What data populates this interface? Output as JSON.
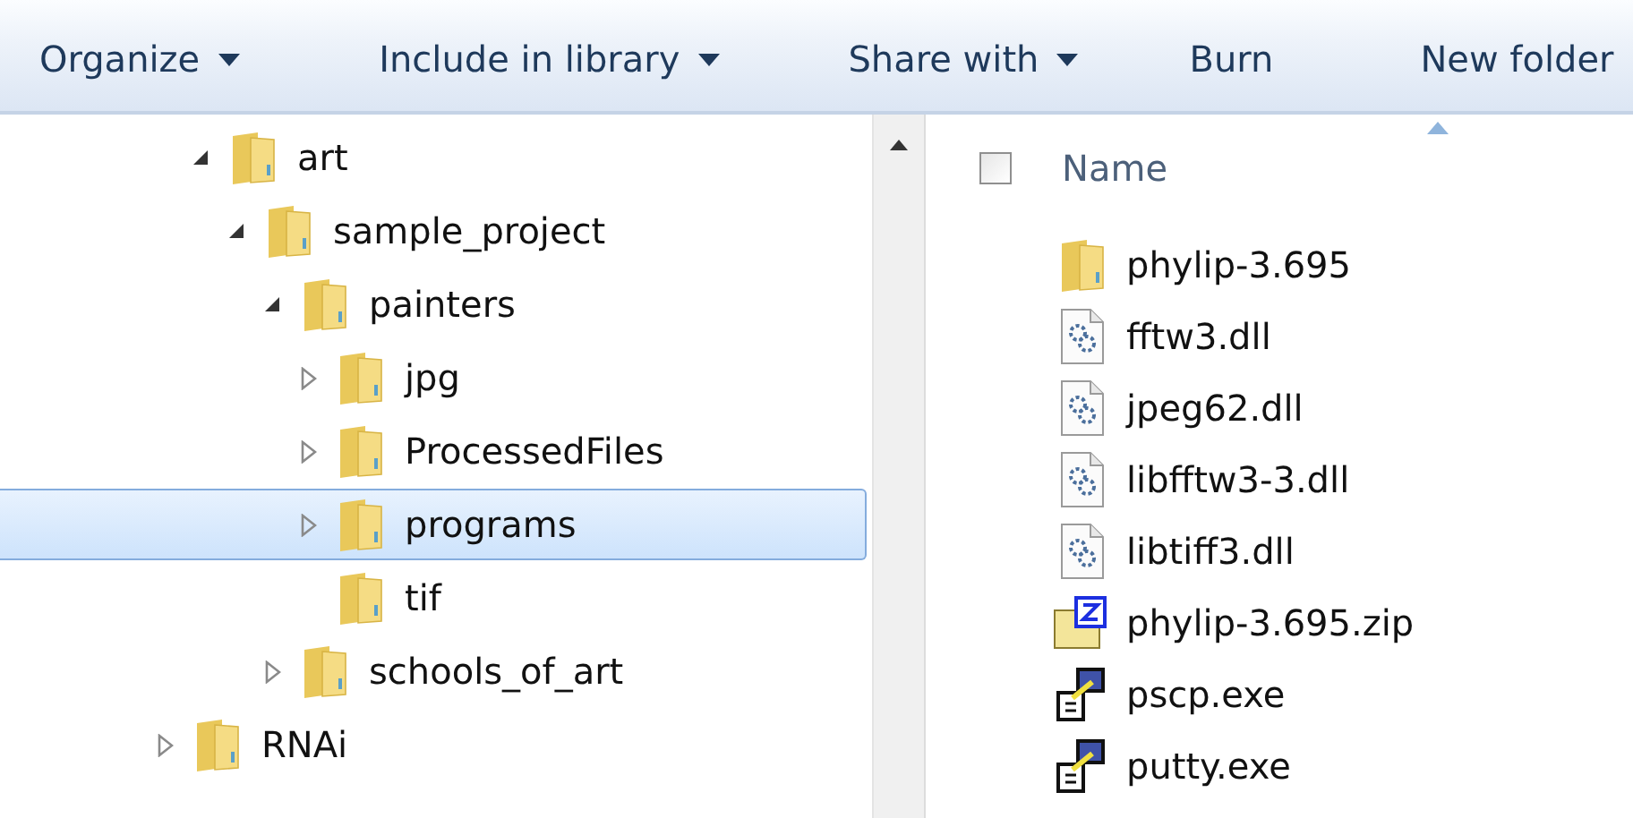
{
  "toolbar": [
    {
      "label": "Organize",
      "has_menu": true
    },
    {
      "label": "Include in library",
      "has_menu": true
    },
    {
      "label": "Share with",
      "has_menu": true
    },
    {
      "label": "Burn",
      "has_menu": false
    },
    {
      "label": "New folder",
      "has_menu": false
    }
  ],
  "tree": {
    "items": [
      {
        "children": [
          {
            "label": "art",
            "expanded": true,
            "selected": false,
            "children": [
              {
                "label": "sample_project",
                "expanded": true,
                "selected": false,
                "children": [
                  {
                    "label": "painters",
                    "expanded": true,
                    "selected": false,
                    "children": [
                      {
                        "label": "jpg",
                        "expanded": false,
                        "has_children": true,
                        "selected": false
                      },
                      {
                        "label": "ProcessedFiles",
                        "expanded": false,
                        "has_children": true,
                        "selected": false
                      },
                      {
                        "label": "programs",
                        "expanded": false,
                        "has_children": true,
                        "selected": true
                      },
                      {
                        "label": "tif",
                        "expanded": false,
                        "has_children": false,
                        "selected": false
                      }
                    ]
                  },
                  {
                    "label": "schools_of_art",
                    "expanded": false,
                    "has_children": true,
                    "selected": false
                  }
                ]
              }
            ]
          }
        ]
      },
      {
        "label": "RNAi",
        "expanded": false,
        "has_children": true,
        "selected": false
      }
    ]
  },
  "file_list": {
    "select_all": {
      "checked": false
    },
    "columns": [
      {
        "label": "Name",
        "sorted": true
      }
    ],
    "files": [
      {
        "name": "phylip-3.695",
        "kind": "folder"
      },
      {
        "name": "fftw3.dll",
        "kind": "dll"
      },
      {
        "name": "jpeg62.dll",
        "kind": "dll"
      },
      {
        "name": "libfftw3-3.dll",
        "kind": "dll"
      },
      {
        "name": "libtiff3.dll",
        "kind": "dll"
      },
      {
        "name": "phylip-3.695.zip",
        "kind": "zip"
      },
      {
        "name": "pscp.exe",
        "kind": "exe"
      },
      {
        "name": "putty.exe",
        "kind": "exe"
      }
    ]
  }
}
